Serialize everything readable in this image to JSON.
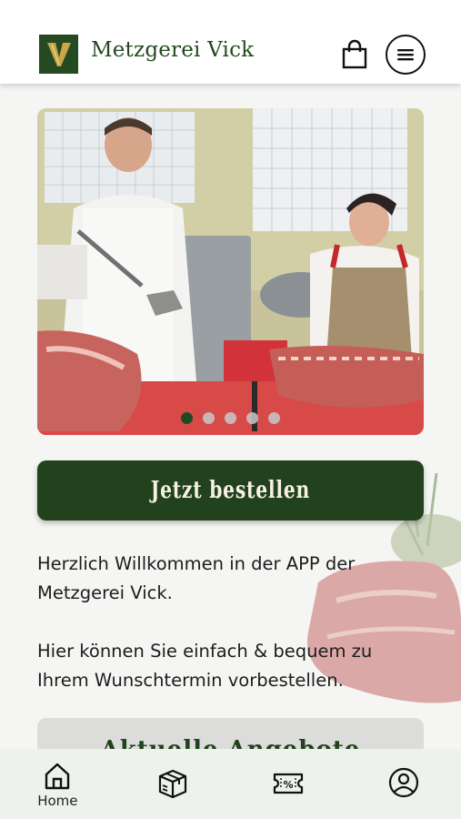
{
  "header": {
    "logo_letter": "V",
    "brand_name": "Metzgerei Vick",
    "cart_icon": "shopping-bag-icon",
    "menu_icon": "menu-icon"
  },
  "hero": {
    "slide_count": 5,
    "active_slide": 1,
    "image_description": "butchers in shop"
  },
  "order_button": {
    "label": "Jetzt bestellen"
  },
  "welcome": {
    "paragraph_1": "Herzlich Willkommen in der APP der Metzgerei Vick.",
    "paragraph_2": "Hier können Sie einfach & bequem zu Ihrem Wunschtermin vorbestellen."
  },
  "offers": {
    "title": "Aktuelle Angebote"
  },
  "bottom_nav": {
    "items": [
      {
        "label": "Home",
        "icon": "home-icon"
      },
      {
        "label": "",
        "icon": "box-icon"
      },
      {
        "label": "",
        "icon": "coupon-icon"
      },
      {
        "label": "",
        "icon": "user-icon"
      }
    ]
  },
  "colors": {
    "brand_green": "#21421d",
    "nav_bg": "#eef2ec"
  }
}
